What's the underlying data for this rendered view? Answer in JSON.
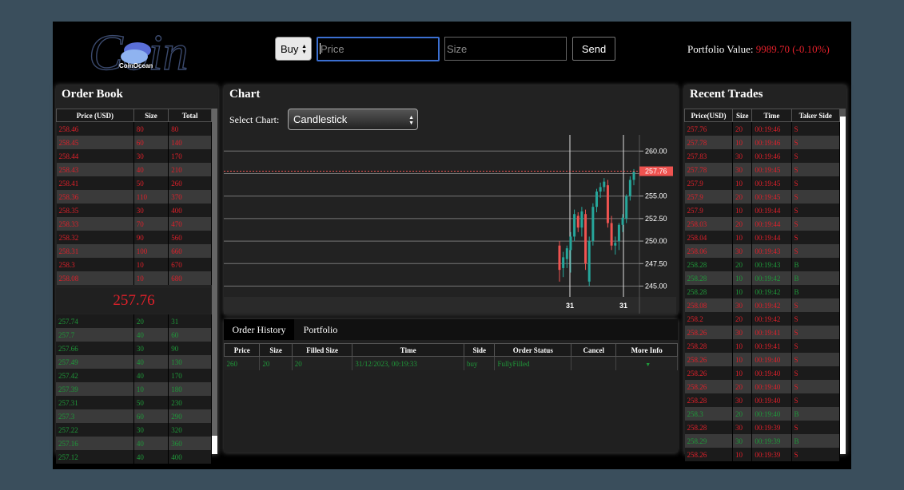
{
  "logo": {
    "script": "Coin",
    "brand": "CoinOcean"
  },
  "order_form": {
    "side": "Buy",
    "price_placeholder": "Price",
    "size_placeholder": "Size",
    "send_label": "Send"
  },
  "portfolio": {
    "label": "Portfolio Value:",
    "value": "9989.70 (-0.10%)"
  },
  "order_book": {
    "title": "Order Book",
    "columns": [
      "Price (USD)",
      "Size",
      "Total"
    ],
    "asks": [
      [
        "258.46",
        "80",
        "80"
      ],
      [
        "258.45",
        "60",
        "140"
      ],
      [
        "258.44",
        "30",
        "170"
      ],
      [
        "258.43",
        "40",
        "210"
      ],
      [
        "258.41",
        "50",
        "260"
      ],
      [
        "258.36",
        "110",
        "370"
      ],
      [
        "258.35",
        "30",
        "400"
      ],
      [
        "258.33",
        "70",
        "470"
      ],
      [
        "258.32",
        "90",
        "560"
      ],
      [
        "258.31",
        "100",
        "660"
      ],
      [
        "258.3",
        "10",
        "670"
      ],
      [
        "258.08",
        "10",
        "680"
      ]
    ],
    "mid_price": "257.76",
    "bids": [
      [
        "257.74",
        "20",
        "31"
      ],
      [
        "257.7",
        "40",
        "60"
      ],
      [
        "257.66",
        "30",
        "90"
      ],
      [
        "257.49",
        "40",
        "130"
      ],
      [
        "257.42",
        "40",
        "170"
      ],
      [
        "257.39",
        "10",
        "180"
      ],
      [
        "257.31",
        "50",
        "230"
      ],
      [
        "257.3",
        "60",
        "290"
      ],
      [
        "257.22",
        "30",
        "320"
      ],
      [
        "257.16",
        "40",
        "360"
      ],
      [
        "257.12",
        "40",
        "400"
      ]
    ]
  },
  "chart": {
    "title": "Chart",
    "select_label": "Select Chart:",
    "selected": "Candlestick",
    "last_price_label": "257.76",
    "x_ticks": [
      "31",
      "31"
    ]
  },
  "chart_data": {
    "type": "candlestick",
    "y_ticks": [
      260.0,
      257.5,
      255.0,
      252.5,
      250.0,
      247.5,
      245.0
    ],
    "ylim": [
      243.8,
      261.8
    ],
    "last_price": 257.76,
    "candles": [
      {
        "o": 249.5,
        "h": 250.0,
        "l": 245.5,
        "c": 246.8
      },
      {
        "o": 247.0,
        "h": 248.8,
        "l": 246.0,
        "c": 248.2
      },
      {
        "o": 248.0,
        "h": 249.5,
        "l": 247.0,
        "c": 249.2
      },
      {
        "o": 249.0,
        "h": 251.0,
        "l": 246.5,
        "c": 250.5
      },
      {
        "o": 250.5,
        "h": 253.5,
        "l": 250.0,
        "c": 253.0
      },
      {
        "o": 252.8,
        "h": 253.2,
        "l": 251.0,
        "c": 251.5
      },
      {
        "o": 251.5,
        "h": 253.8,
        "l": 250.5,
        "c": 253.3
      },
      {
        "o": 253.0,
        "h": 253.5,
        "l": 246.8,
        "c": 247.5
      },
      {
        "o": 245.5,
        "h": 250.5,
        "l": 245.0,
        "c": 250.0
      },
      {
        "o": 250.0,
        "h": 254.2,
        "l": 249.5,
        "c": 253.8
      },
      {
        "o": 253.8,
        "h": 255.8,
        "l": 253.2,
        "c": 255.5
      },
      {
        "o": 255.5,
        "h": 256.5,
        "l": 254.8,
        "c": 256.0
      },
      {
        "o": 256.0,
        "h": 257.0,
        "l": 255.5,
        "c": 256.6
      },
      {
        "o": 256.2,
        "h": 256.8,
        "l": 251.5,
        "c": 252.0
      },
      {
        "o": 252.0,
        "h": 252.8,
        "l": 249.0,
        "c": 249.5
      },
      {
        "o": 249.5,
        "h": 250.5,
        "l": 248.5,
        "c": 249.8
      },
      {
        "o": 250.0,
        "h": 252.0,
        "l": 249.0,
        "c": 251.8
      },
      {
        "o": 251.8,
        "h": 253.0,
        "l": 251.0,
        "c": 252.6
      },
      {
        "o": 252.5,
        "h": 255.2,
        "l": 252.0,
        "c": 255.0
      },
      {
        "o": 255.0,
        "h": 257.2,
        "l": 254.5,
        "c": 256.8
      },
      {
        "o": 256.8,
        "h": 258.0,
        "l": 256.2,
        "c": 257.7
      }
    ]
  },
  "order_history": {
    "tabs": [
      "Order History",
      "Portfolio"
    ],
    "columns": [
      "Price",
      "Size",
      "Filled Size",
      "Time",
      "Side",
      "Order Status",
      "Cancel",
      "More Info"
    ],
    "rows": [
      [
        "260",
        "20",
        "20",
        "31/12/2023, 00:19:33",
        "buy",
        "FullyFilled",
        "",
        ""
      ]
    ]
  },
  "recent_trades": {
    "title": "Recent Trades",
    "columns": [
      "Price(USD)",
      "Size",
      "Time",
      "Taker Side"
    ],
    "rows": [
      [
        "257.76",
        "20",
        "00:19:46",
        "S"
      ],
      [
        "257.78",
        "10",
        "00:19:46",
        "S"
      ],
      [
        "257.83",
        "30",
        "00:19:46",
        "S"
      ],
      [
        "257.78",
        "30",
        "00:19:45",
        "S"
      ],
      [
        "257.9",
        "10",
        "00:19:45",
        "S"
      ],
      [
        "257.9",
        "20",
        "00:19:45",
        "S"
      ],
      [
        "257.9",
        "10",
        "00:19:44",
        "S"
      ],
      [
        "258.03",
        "20",
        "00:19:44",
        "S"
      ],
      [
        "258.04",
        "10",
        "00:19:44",
        "S"
      ],
      [
        "258.06",
        "30",
        "00:19:43",
        "S"
      ],
      [
        "258.28",
        "20",
        "00:19:43",
        "B"
      ],
      [
        "258.28",
        "10",
        "00:19:42",
        "B"
      ],
      [
        "258.28",
        "10",
        "00:19:42",
        "B"
      ],
      [
        "258.08",
        "30",
        "00:19:42",
        "S"
      ],
      [
        "258.2",
        "20",
        "00:19:42",
        "S"
      ],
      [
        "258.26",
        "30",
        "00:19:41",
        "S"
      ],
      [
        "258.28",
        "10",
        "00:19:41",
        "S"
      ],
      [
        "258.26",
        "10",
        "00:19:40",
        "S"
      ],
      [
        "258.26",
        "10",
        "00:19:40",
        "S"
      ],
      [
        "258.26",
        "20",
        "00:19:40",
        "S"
      ],
      [
        "258.28",
        "30",
        "00:19:40",
        "S"
      ],
      [
        "258.3",
        "20",
        "00:19:40",
        "B"
      ],
      [
        "258.28",
        "30",
        "00:19:39",
        "S"
      ],
      [
        "258.29",
        "30",
        "00:19:39",
        "B"
      ],
      [
        "258.26",
        "10",
        "00:19:39",
        "S"
      ]
    ]
  },
  "colors": {
    "ask": "#e0202a",
    "bid": "#1f9a3a",
    "up": "#26a69a",
    "down": "#ef5350",
    "accent": "#3b6fd1"
  }
}
